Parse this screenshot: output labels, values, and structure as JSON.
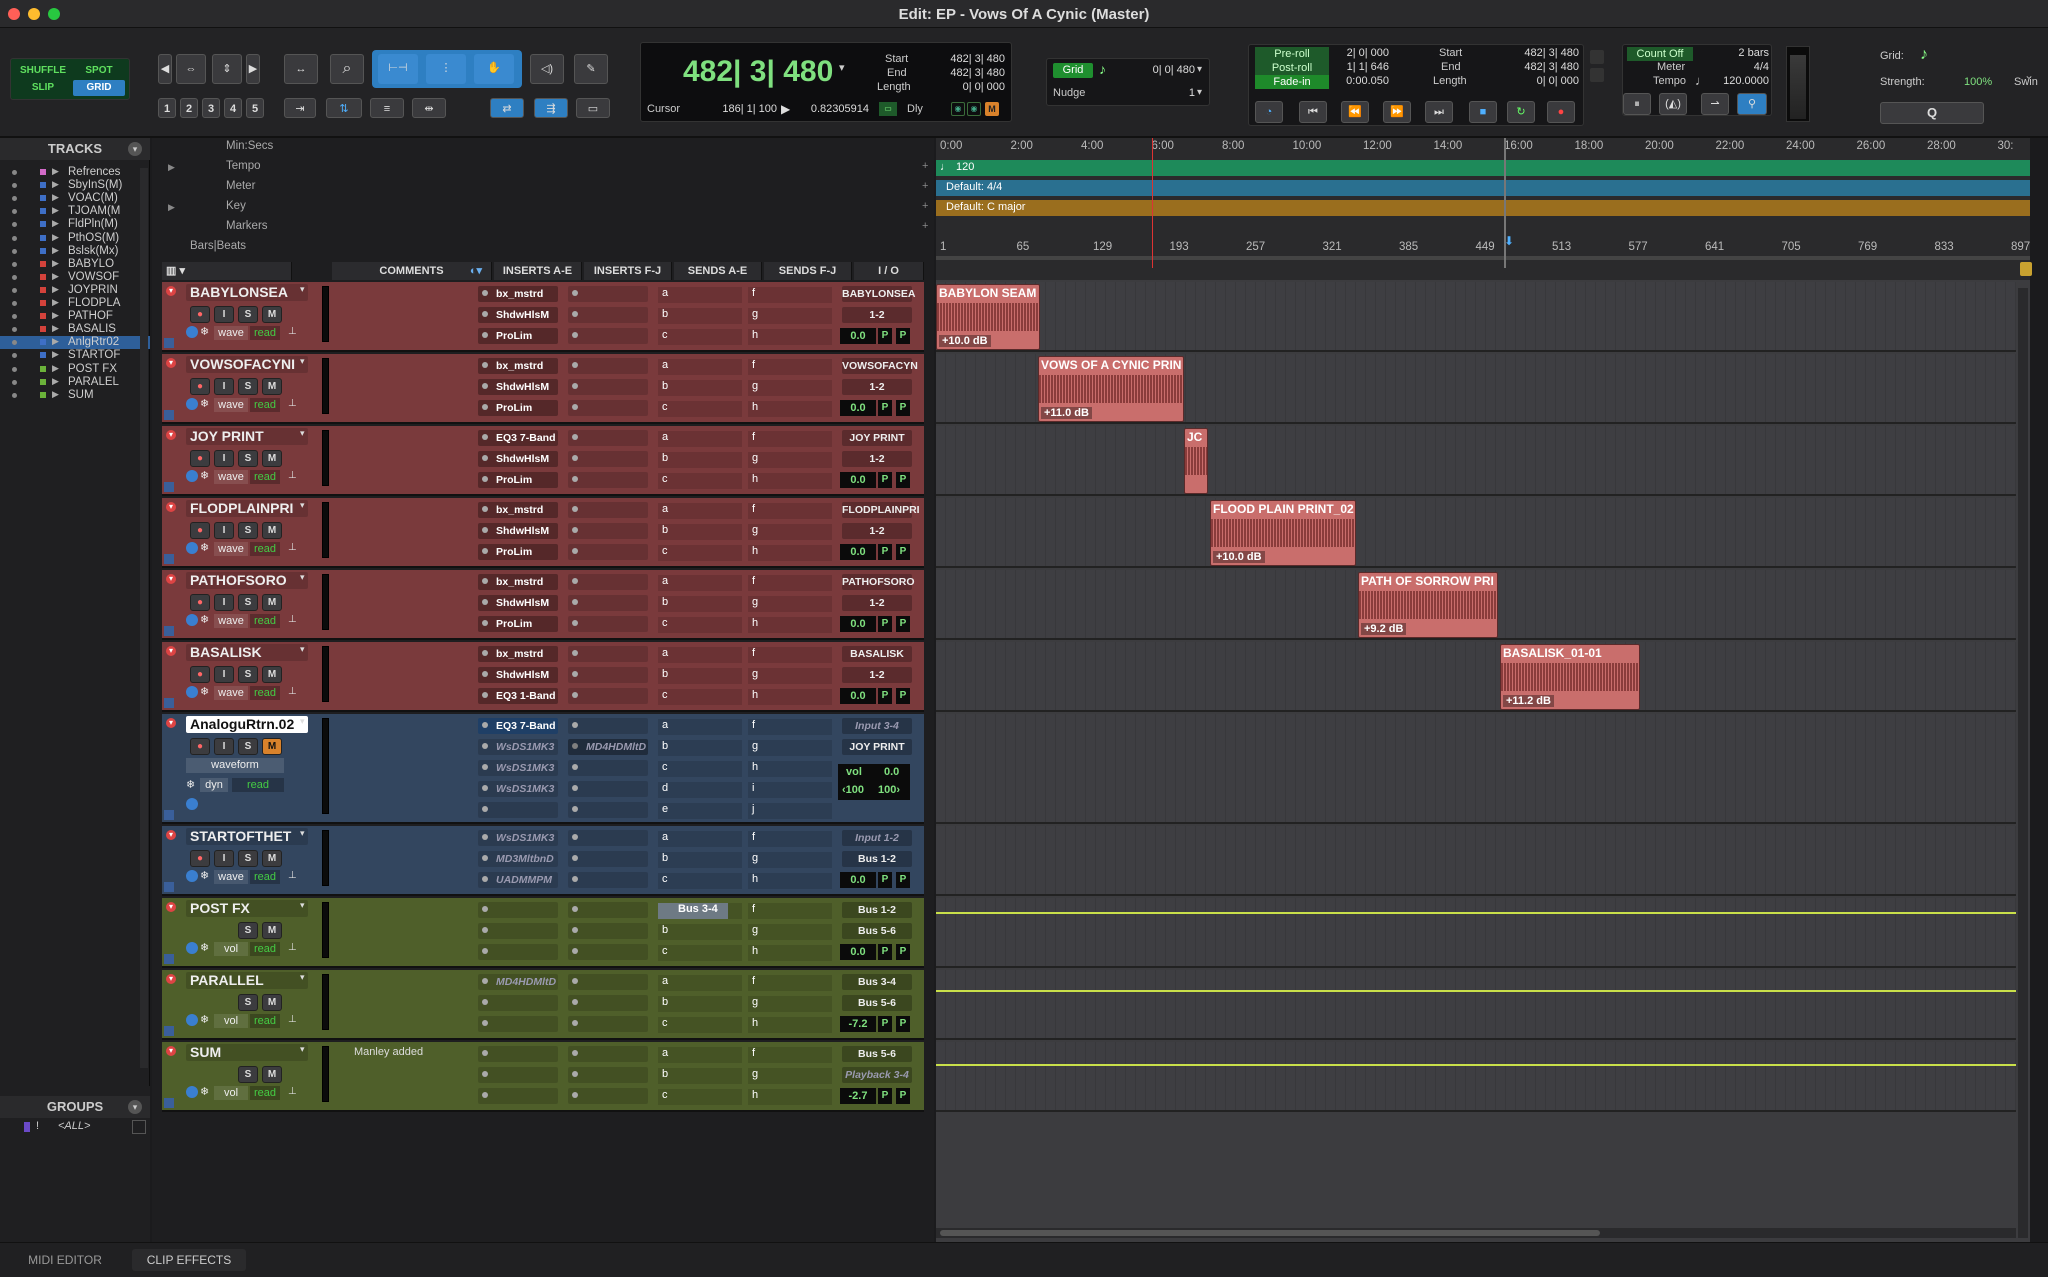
{
  "window": {
    "title": "Edit: EP - Vows Of A Cynic (Master)"
  },
  "toolbar": {
    "modes": {
      "shuffle": "SHUFFLE",
      "spot": "SPOT",
      "slip": "SLIP",
      "grid": "GRID"
    },
    "zoom_presets": [
      "1",
      "2",
      "3",
      "4",
      "5"
    ],
    "main_counter": "482| 3| 480",
    "sel": {
      "start_label": "Start",
      "end_label": "End",
      "length_label": "Length",
      "start": "482| 3| 480",
      "end": "482| 3| 480",
      "length": "0| 0| 000"
    },
    "cursor_label": "Cursor",
    "cursor_value": "186| 1| 100",
    "cursor_sample": "0.82305914",
    "dly_label": "Dly",
    "grid_label": "Grid",
    "grid_value": "0| 0| 480",
    "nudge_label": "Nudge",
    "nudge_value": "1",
    "preroll_label": "Pre-roll",
    "preroll": "2| 0| 000",
    "postroll_label": "Post-roll",
    "postroll": "1| 1| 646",
    "fadein_label": "Fade-in",
    "fadein": "0:00.050",
    "trans": {
      "start": "482| 3| 480",
      "end": "482| 3| 480",
      "length": "0| 0| 000"
    },
    "count_off_label": "Count Off",
    "count_off": "2 bars",
    "meter_label": "Meter",
    "meter": "4/4",
    "tempo_label": "Tempo",
    "tempo": "120.0000",
    "grid_right_label": "Grid:",
    "strength_label": "Strength:",
    "strength": "100%",
    "swing_label": "Swin",
    "q_label": "Q"
  },
  "tracks_panel": {
    "header": "TRACKS",
    "items": [
      {
        "name": "Refrences",
        "color": "#d26ac8"
      },
      {
        "name": "SbyInS(M)",
        "color": "#3e6fc7"
      },
      {
        "name": "VOAC(M)",
        "color": "#3e6fc7"
      },
      {
        "name": "TJOAM(M",
        "color": "#3e6fc7"
      },
      {
        "name": "FldPln(M)",
        "color": "#3e6fc7"
      },
      {
        "name": "PthOS(M)",
        "color": "#3e6fc7"
      },
      {
        "name": "Bslsk(Mx)",
        "color": "#3e6fc7"
      },
      {
        "name": "BABYLO",
        "color": "#d4423b"
      },
      {
        "name": "VOWSOF",
        "color": "#d4423b"
      },
      {
        "name": "JOYPRIN",
        "color": "#d4423b"
      },
      {
        "name": "FLODPLA",
        "color": "#d4423b"
      },
      {
        "name": "PATHOF",
        "color": "#d4423b"
      },
      {
        "name": "BASALIS",
        "color": "#d4423b"
      },
      {
        "name": "AnlgRtr02",
        "color": "#3e6fc7"
      },
      {
        "name": "STARTOF",
        "color": "#3e6fc7"
      },
      {
        "name": "POST FX",
        "color": "#6bb23a"
      },
      {
        "name": "PARALEL",
        "color": "#6bb23a"
      },
      {
        "name": "SUM",
        "color": "#6bb23a"
      }
    ]
  },
  "groups_panel": {
    "header": "GROUPS",
    "all": "<ALL>"
  },
  "rulers": {
    "min_secs": "Min:Secs",
    "tempo": "Tempo",
    "meter": "Meter",
    "key": "Key",
    "markers": "Markers",
    "bars_beats": "Bars|Beats",
    "tempo_value": "120",
    "meter_value": "Default: 4/4",
    "key_value": "Default: C major",
    "min_ticks": [
      "0:00",
      "2:00",
      "4:00",
      "6:00",
      "8:00",
      "10:00",
      "12:00",
      "14:00",
      "16:00",
      "18:00",
      "20:00",
      "22:00",
      "24:00",
      "26:00",
      "28:00",
      "30:"
    ],
    "bar_ticks": [
      "1",
      "65",
      "129",
      "193",
      "257",
      "321",
      "385",
      "449",
      "513",
      "577",
      "641",
      "705",
      "769",
      "833",
      "897"
    ]
  },
  "columns": {
    "comments": "COMMENTS",
    "inserts_ae": "INSERTS A-E",
    "inserts_fj": "INSERTS F-J",
    "sends_ae": "SENDS A-E",
    "sends_fj": "SENDS F-J",
    "io": "I / O"
  },
  "mixer_labels": {
    "wave": "wave",
    "read": "read",
    "vol": "vol",
    "waveform": "waveform",
    "dyn": "dyn",
    "p": "P",
    "sends_a": [
      "a",
      "b",
      "c",
      "d",
      "e"
    ],
    "sends_f": [
      "f",
      "g",
      "h",
      "i",
      "j"
    ]
  },
  "tracks": [
    {
      "name": "BABYLONSEA",
      "inserts": [
        "bx_mstrd",
        "ShdwHlsM",
        "ProLim"
      ],
      "io_in": "BABYLONSEA",
      "io_out": "1-2",
      "vol": "0.0"
    },
    {
      "name": "VOWSOFACYNI",
      "inserts": [
        "bx_mstrd",
        "ShdwHlsM",
        "ProLim"
      ],
      "io_in": "VOWSOFACYN",
      "io_out": "1-2",
      "vol": "0.0"
    },
    {
      "name": "JOY PRINT",
      "inserts": [
        "EQ3 7-Band",
        "ShdwHlsM",
        "ProLim"
      ],
      "io_in": "JOY PRINT",
      "io_out": "1-2",
      "vol": "0.0"
    },
    {
      "name": "FLODPLAINPRI",
      "inserts": [
        "bx_mstrd",
        "ShdwHlsM",
        "ProLim"
      ],
      "io_in": "FLODPLAINPRI",
      "io_out": "1-2",
      "vol": "0.0"
    },
    {
      "name": "PATHOFSORO",
      "inserts": [
        "bx_mstrd",
        "ShdwHlsM",
        "ProLim"
      ],
      "io_in": "PATHOFSORO",
      "io_out": "1-2",
      "vol": "0.0"
    },
    {
      "name": "BASALISK",
      "inserts": [
        "bx_mstrd",
        "ShdwHlsM",
        "EQ3 1-Band"
      ],
      "io_in": "BASALISK",
      "io_out": "1-2",
      "vol": "0.0"
    },
    {
      "name": "AnaloguRtrn.02",
      "inserts": [
        "EQ3 7-Band",
        "WsDS1MK3",
        "WsDS1MK3",
        "WsDS1MK3"
      ],
      "insert_f": "MD4HDMltD",
      "io_in": "Input 3-4",
      "io_out": "JOY PRINT",
      "vol_label": "vol",
      "vol": "0.0",
      "pan_l": "‹100",
      "pan_r": "100›"
    },
    {
      "name": "STARTOFTHET",
      "inserts": [
        "WsDS1MK3",
        "MD3MltbnD",
        "UADMMPM"
      ],
      "io_in": "Input 1-2",
      "io_out": "Bus 1-2",
      "vol": "0.0"
    },
    {
      "name": "POST FX",
      "send": "Bus 3-4",
      "io_in": "Bus 1-2",
      "io_out": "Bus 5-6",
      "vol": "0.0"
    },
    {
      "name": "PARALLEL",
      "inserts": [
        "MD4HDMltD"
      ],
      "io_in": "Bus 3-4",
      "io_out": "Bus 5-6",
      "vol": "-7.2"
    },
    {
      "name": "SUM",
      "comment": "Manley added",
      "io_in": "Bus 5-6",
      "io_out": "Playback 3-4",
      "vol": "-2.7"
    }
  ],
  "clips": [
    {
      "name": "BABYLON SEAM",
      "gain": "+10.0 dB"
    },
    {
      "name": "VOWS OF A CYNIC PRIN",
      "gain": "+11.0 dB"
    },
    {
      "name": "JC",
      "gain": ""
    },
    {
      "name": "FLOOD PLAIN PRINT_02",
      "gain": "+10.0 dB"
    },
    {
      "name": "PATH OF SORROW PRI",
      "gain": "+9.2 dB"
    },
    {
      "name": "BASALISK_01-01",
      "gain": "+11.2 dB"
    }
  ],
  "bottom_tabs": {
    "midi_editor": "MIDI EDITOR",
    "clip_effects": "CLIP EFFECTS"
  },
  "colors": {
    "audio_track": "#7a3a3c",
    "aux_track": "#33465f",
    "master_track": "#4f5f2a",
    "accent_blue": "#2e7fc2"
  }
}
